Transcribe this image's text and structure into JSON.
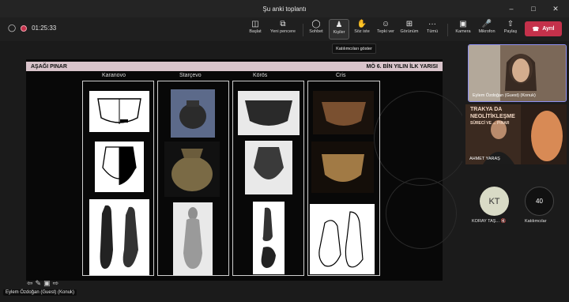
{
  "window": {
    "title": "Şu anki toplantı"
  },
  "meeting": {
    "timer": "01:25:33"
  },
  "toolbar": {
    "share_label": "Başlat",
    "new_window_label": "Yeni pencere",
    "chat_label": "Sohbet",
    "people_label": "Kişiler",
    "raise_hand_label": "Söz iste",
    "react_label": "Tepki ver",
    "view_label": "Görünüm",
    "more_label": "Tümü",
    "camera_label": "Kamera",
    "mic_label": "Mikrofon",
    "present_label": "Paylaş",
    "leave_label": "Ayrıl"
  },
  "tooltip": {
    "text": "Katılımcıları göster"
  },
  "slide": {
    "left_title": "AŞAĞI PINAR",
    "right_title": "MÖ 6. BİN YILIN İLK YARISI",
    "cultures": [
      "Karanovo",
      "Starçevo",
      "Körös",
      "Cris"
    ]
  },
  "presenter": {
    "name": "Eylem Özdoğan (Guest) (Konuk)"
  },
  "participants": {
    "video1_name": "Eylem Özdoğan (Guest) (Konuk)",
    "video2_name": "AHMET YARAŞ",
    "avatar_initials": "KT",
    "avatar_name": "KORAY TAŞ...",
    "count": "40",
    "count_label": "Katılımcılar",
    "poster_lines": [
      "TRAKYA DA",
      "NEOLİTİKLEŞME",
      "SÜRECİ VE ... PINAR"
    ]
  },
  "colors": {
    "accent": "#8e90f0",
    "leave": "#c4314b",
    "slide_bar": "#d9c4cb"
  }
}
